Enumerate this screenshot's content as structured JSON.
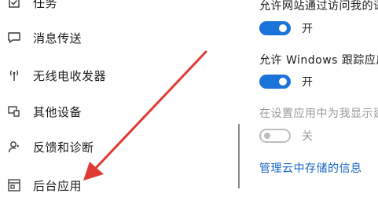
{
  "sidebar": {
    "items": [
      {
        "label": "任务",
        "icon": "task-icon"
      },
      {
        "label": "消息传送",
        "icon": "chat-icon"
      },
      {
        "label": "无线电收发器",
        "icon": "radio-antenna-icon"
      },
      {
        "label": "其他设备",
        "icon": "devices-icon"
      },
      {
        "label": "反馈和诊断",
        "icon": "feedback-icon"
      },
      {
        "label": "后台应用",
        "icon": "background-apps-icon"
      }
    ]
  },
  "settings": {
    "items": [
      {
        "desc": "允许网站通过访问我的语言列表",
        "toggle_label": "开",
        "state": "on"
      },
      {
        "desc": "允许 Windows 跟踪应用启动",
        "toggle_label": "开",
        "state": "on"
      },
      {
        "desc": "在设置应用中为我显示建议的内容",
        "toggle_label": "关",
        "state": "off-disabled"
      }
    ],
    "link": "管理云中存储的信息"
  },
  "colors": {
    "accent": "#1a73d9",
    "link": "#1565c0",
    "annotation_arrow": "#e03a32"
  }
}
